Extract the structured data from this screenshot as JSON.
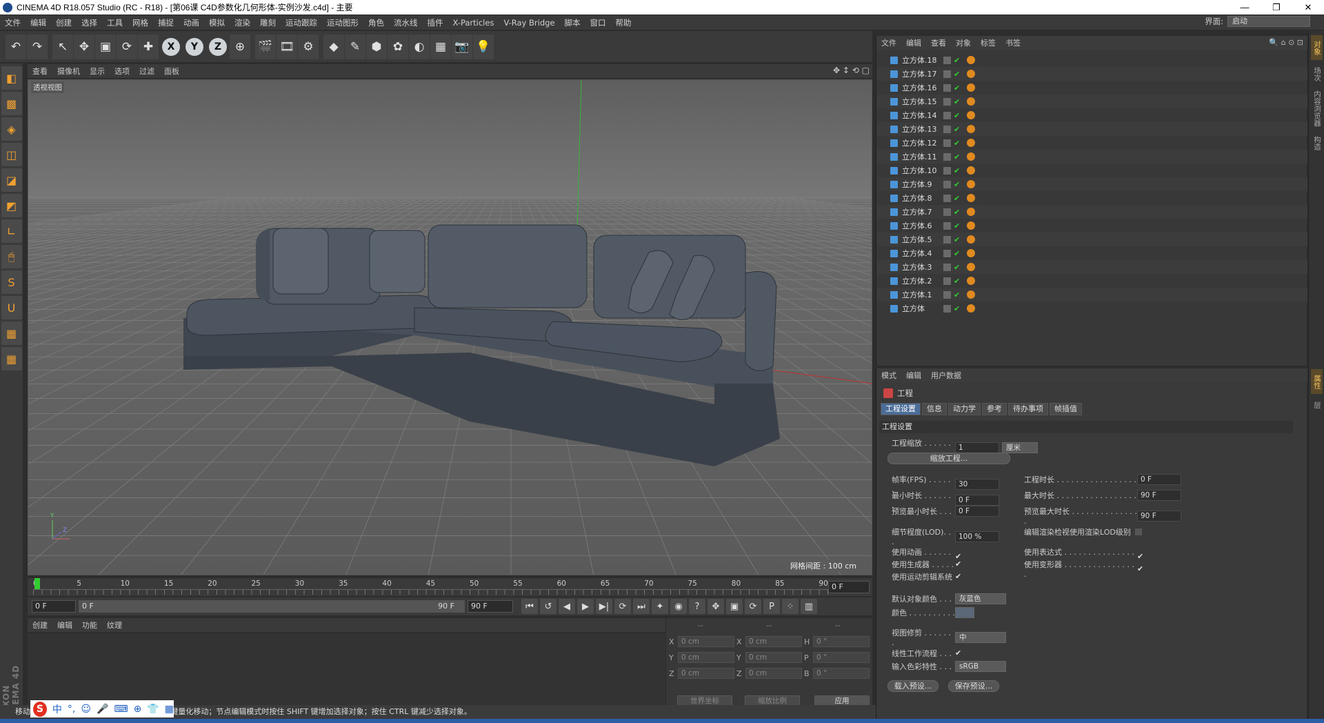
{
  "window": {
    "title": "CINEMA 4D R18.057 Studio (RC - R18) - [第06课   C4D参数化几何形体-实例沙发.c4d] - 主要",
    "controls": [
      "—",
      "❐",
      "✕"
    ]
  },
  "menubar": {
    "items": [
      "文件",
      "编辑",
      "创建",
      "选择",
      "工具",
      "网格",
      "捕捉",
      "动画",
      "模拟",
      "渲染",
      "雕刻",
      "运动跟踪",
      "运动图形",
      "角色",
      "流水线",
      "插件",
      "X-Particles",
      "V-Ray Bridge",
      "脚本",
      "窗口",
      "帮助"
    ],
    "interface_label": "界面:",
    "interface_value": "启动"
  },
  "toolbar": {
    "buttons": [
      {
        "name": "undo",
        "glyph": "↶"
      },
      {
        "name": "redo",
        "glyph": "↷"
      },
      {
        "name": "live-selection",
        "glyph": "↖"
      },
      {
        "name": "move",
        "glyph": "✥"
      },
      {
        "name": "scale",
        "glyph": "▣"
      },
      {
        "name": "rotate",
        "glyph": "⟳"
      },
      {
        "name": "recent-tool",
        "glyph": "✚"
      },
      {
        "name": "x-axis",
        "glyph": "X"
      },
      {
        "name": "y-axis",
        "glyph": "Y"
      },
      {
        "name": "z-axis",
        "glyph": "Z"
      },
      {
        "name": "coordinate-system",
        "glyph": "⊕"
      },
      {
        "name": "render-view",
        "glyph": "🎬"
      },
      {
        "name": "render-picture-viewer",
        "glyph": "🎞"
      },
      {
        "name": "edit-render-settings",
        "glyph": "⚙"
      },
      {
        "name": "cube-object",
        "glyph": "◆"
      },
      {
        "name": "pen-spline",
        "glyph": "✎"
      },
      {
        "name": "subdivision-surface",
        "glyph": "⬢"
      },
      {
        "name": "array",
        "glyph": "✿"
      },
      {
        "name": "deformer",
        "glyph": "◐"
      },
      {
        "name": "floor",
        "glyph": "▦"
      },
      {
        "name": "camera",
        "glyph": "📷"
      },
      {
        "name": "light",
        "glyph": "💡"
      }
    ]
  },
  "lefttools": [
    "◧",
    "▩",
    "◈",
    "◫",
    "◪",
    "◩",
    "∟",
    "🖱",
    "S",
    "U",
    "▦",
    "▦"
  ],
  "viewport": {
    "menu": [
      "查看",
      "摄像机",
      "显示",
      "选项",
      "过滤",
      "面板"
    ],
    "label": "透视视图",
    "grid_info": "网格间距 : 100 cm",
    "nav_icons": "✥ ↕ ⟲ ▢"
  },
  "timeline": {
    "ticks": [
      "0",
      "5",
      "10",
      "15",
      "20",
      "25",
      "30",
      "35",
      "40",
      "45",
      "50",
      "55",
      "60",
      "65",
      "70",
      "75",
      "80",
      "85",
      "90"
    ],
    "current_frame": "0 F"
  },
  "transport": {
    "start": "0 F",
    "range_start": "0 F",
    "range_end": "90 F",
    "end": "90 F",
    "buttons": [
      "⏮",
      "↺",
      "◀",
      "▶",
      "▶|",
      "⟳",
      "⏭",
      "✦",
      "◉",
      "?",
      "✥",
      "▣",
      "⟳",
      "P",
      "⁘",
      "▥"
    ]
  },
  "material": {
    "menu": [
      "创建",
      "编辑",
      "功能",
      "纹理"
    ]
  },
  "coords": {
    "headers": [
      "--",
      "--",
      "--"
    ],
    "rows": [
      [
        "X",
        "0 cm",
        "X",
        "0 cm",
        "H",
        "0 °"
      ],
      [
        "Y",
        "0 cm",
        "Y",
        "0 cm",
        "P",
        "0 °"
      ],
      [
        "Z",
        "0 cm",
        "Z",
        "0 cm",
        "B",
        "0 °"
      ]
    ],
    "world": "世界坐标",
    "scale": "缩放比例",
    "apply": "应用"
  },
  "statusbar": {
    "text": "移动：点击并拖动鼠标移动元素。按住 SHIFT 键量化移动；节点编辑模式时按住 SHIFT 键增加选择对象；按住 CTRL 键减少选择对象。"
  },
  "ime": {
    "logo": "S",
    "items": [
      "中",
      "°,",
      "☺",
      "🎤",
      "⌨",
      "⊕",
      "👕",
      "▦"
    ]
  },
  "objects": {
    "menu": [
      "文件",
      "编辑",
      "查看",
      "对象",
      "标签",
      "书签"
    ],
    "icons": "🔍 ⌂ ⊙ ⊡",
    "items": [
      "立方体.18",
      "立方体.17",
      "立方体.16",
      "立方体.15",
      "立方体.14",
      "立方体.13",
      "立方体.12",
      "立方体.11",
      "立方体.10",
      "立方体.9",
      "立方体.8",
      "立方体.7",
      "立方体.6",
      "立方体.5",
      "立方体.4",
      "立方体.3",
      "立方体.2",
      "立方体.1",
      "立方体"
    ]
  },
  "attributes": {
    "menu": [
      "模式",
      "编辑",
      "用户数据"
    ],
    "title": "工程",
    "tabs": [
      "工程设置",
      "信息",
      "动力学",
      "参考",
      "待办事项",
      "帧插值"
    ],
    "section": "工程设置",
    "scale_label": "工程缩放 . . . . . . .",
    "scale_value": "1",
    "scale_unit": "厘米",
    "scale_button": "缩放工程...",
    "fps_label": "帧率(FPS) . . . . . .",
    "fps": "30",
    "duration_label": "工程时长 . . . . . . . . . . . . . . . . .",
    "duration": "0 F",
    "min_label": "最小时长 . . . . . . .",
    "min": "0 F",
    "max_label": "最大时长 . . . . . . . . . . . . . . . . .",
    "max": "90 F",
    "pmin_label": "预览最小时长 . . .",
    "pmin": "0 F",
    "pmax_label": "预览最大时长 . . . . . . . . . . . . . . .",
    "pmax": "90 F",
    "lod_label": "细节程度(LOD). . .",
    "lod": "100 %",
    "lod_render_label": "编辑渲染检视使用渲染LOD级别",
    "use_anim": "使用动画 . . . . . . .",
    "use_expr": "使用表达式 . . . . . . . . . . . . . . . .",
    "use_gen": "使用生成器 . . . . .",
    "use_deform": "使用变形器 . . . . . . . . . . . . . . . .",
    "use_motion": "使用运动剪辑系统",
    "check": "✔",
    "default_color_label": "默认对象颜色 . . .",
    "default_color": "灰蓝色",
    "color_label": "颜色 . . . . . . . . . .",
    "view_clip_label": "视图修剪 . . . . . . .",
    "view_clip": "中",
    "linear_label": "线性工作流程 . . .",
    "input_color_label": "输入色彩特性 . . .",
    "input_color": "sRGB",
    "load_preset": "载入预设...",
    "save_preset": "保存预设..."
  },
  "sidetabs": {
    "top": [
      "对象",
      "场次",
      "内容浏览器",
      "构造"
    ],
    "bottom": [
      "属性",
      "层"
    ]
  },
  "colors": {
    "accent": "#4b6d98",
    "cube_icon": "#4b95d8",
    "tag": "#e08a20"
  }
}
